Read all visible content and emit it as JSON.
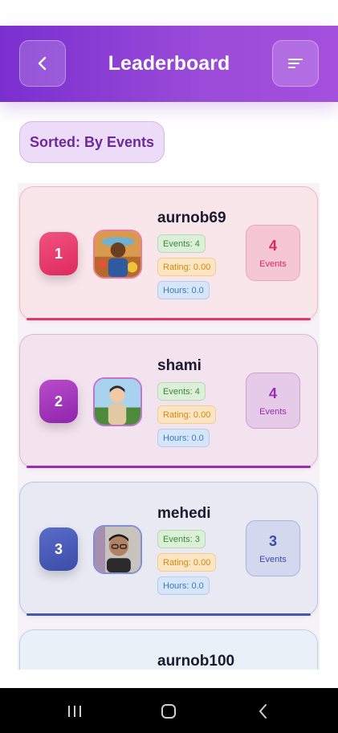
{
  "header": {
    "title": "Leaderboard",
    "back_icon": "chevron-left-icon",
    "sort_icon": "sort-icon"
  },
  "sort_chip": {
    "label": "Sorted: By Events"
  },
  "entries": [
    {
      "rank": "1",
      "name": "aurnob69",
      "events_pill": "Events: 4",
      "rating_pill": "Rating: 0.00",
      "hours_pill": "Hours: 0.0",
      "count": "4",
      "count_label": "Events"
    },
    {
      "rank": "2",
      "name": "shami",
      "events_pill": "Events: 4",
      "rating_pill": "Rating: 0.00",
      "hours_pill": "Hours: 0.0",
      "count": "4",
      "count_label": "Events"
    },
    {
      "rank": "3",
      "name": "mehedi",
      "events_pill": "Events: 3",
      "rating_pill": "Rating: 0.00",
      "hours_pill": "Hours: 0.0",
      "count": "3",
      "count_label": "Events"
    },
    {
      "name": "aurnob100"
    }
  ],
  "colors": {
    "header_start": "#7a2fcf",
    "header_end": "#a54fdf",
    "rank1": "#e8336b",
    "rank2": "#9b2bb5",
    "rank3": "#4356b8",
    "events_pill": "#3c8a3a",
    "rating_pill": "#d28a12",
    "hours_pill": "#3a79c0"
  },
  "system_nav": {
    "recents_icon": "recents-icon",
    "home_icon": "home-icon",
    "back_icon": "back-icon"
  }
}
